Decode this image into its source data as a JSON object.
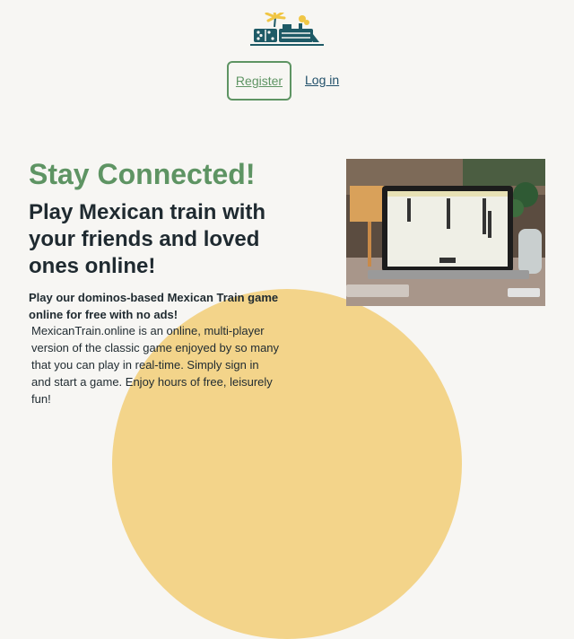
{
  "header": {
    "logo_icon": "train-domino-logo-icon"
  },
  "auth": {
    "register_label": "Register",
    "login_label": "Log in"
  },
  "hero": {
    "headline": "Stay Connected!",
    "subheadline": "Play Mexican train with your friends and loved ones online!",
    "lead": "Play our dominos-based Mexican Train game online for free with no ads!",
    "description": "MexicanTrain.online is an online, multi-player version of the classic game enjoyed by so many that you can play in real-time. Simply sign in and start a game. Enjoy hours of free, leisurely fun!"
  },
  "colors": {
    "background": "#f7f6f3",
    "accent_green": "#5e9463",
    "sun_yellow": "#f3d48a",
    "text_dark": "#1f2a30",
    "link_blue": "#22506a",
    "logo_teal": "#1e5a66"
  }
}
